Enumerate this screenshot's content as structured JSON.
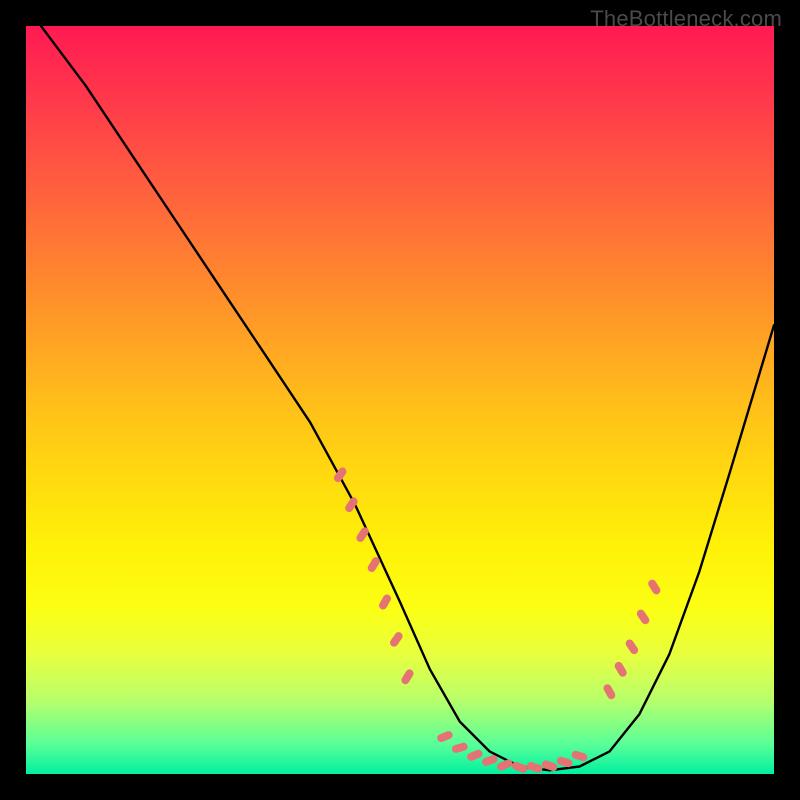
{
  "watermark": "TheBottleneck.com",
  "gradient": {
    "top": "#ff1a52",
    "mid": "#ffd90f",
    "bottom": "#00f0a0"
  },
  "marker_color": "#e57373",
  "chart_data": {
    "type": "line",
    "title": "",
    "xlabel": "",
    "ylabel": "",
    "xlim": [
      0,
      100
    ],
    "ylim": [
      0,
      100
    ],
    "series": [
      {
        "name": "curve",
        "x": [
          2,
          8,
          14,
          20,
          26,
          32,
          38,
          44,
          50,
          54,
          58,
          62,
          66,
          70,
          74,
          78,
          82,
          86,
          90,
          94,
          100
        ],
        "y": [
          100,
          92,
          83,
          74,
          65,
          56,
          47,
          36,
          23,
          14,
          7,
          3,
          1,
          0.5,
          1,
          3,
          8,
          16,
          27,
          40,
          60
        ]
      }
    ],
    "markers": {
      "left_cluster": {
        "x": [
          42,
          43.5,
          45,
          46.5,
          48,
          49.5,
          51
        ],
        "y": [
          40,
          36,
          32,
          28,
          23,
          18,
          13
        ]
      },
      "bottom_cluster": {
        "x": [
          56,
          58,
          60,
          62,
          64,
          66,
          68,
          70,
          72,
          74
        ],
        "y": [
          5,
          3.5,
          2.5,
          1.8,
          1.2,
          0.9,
          0.9,
          1.1,
          1.6,
          2.4
        ]
      },
      "right_cluster": {
        "x": [
          78,
          79.5,
          81,
          82.5,
          84
        ],
        "y": [
          11,
          14,
          17,
          21,
          25
        ]
      }
    }
  }
}
